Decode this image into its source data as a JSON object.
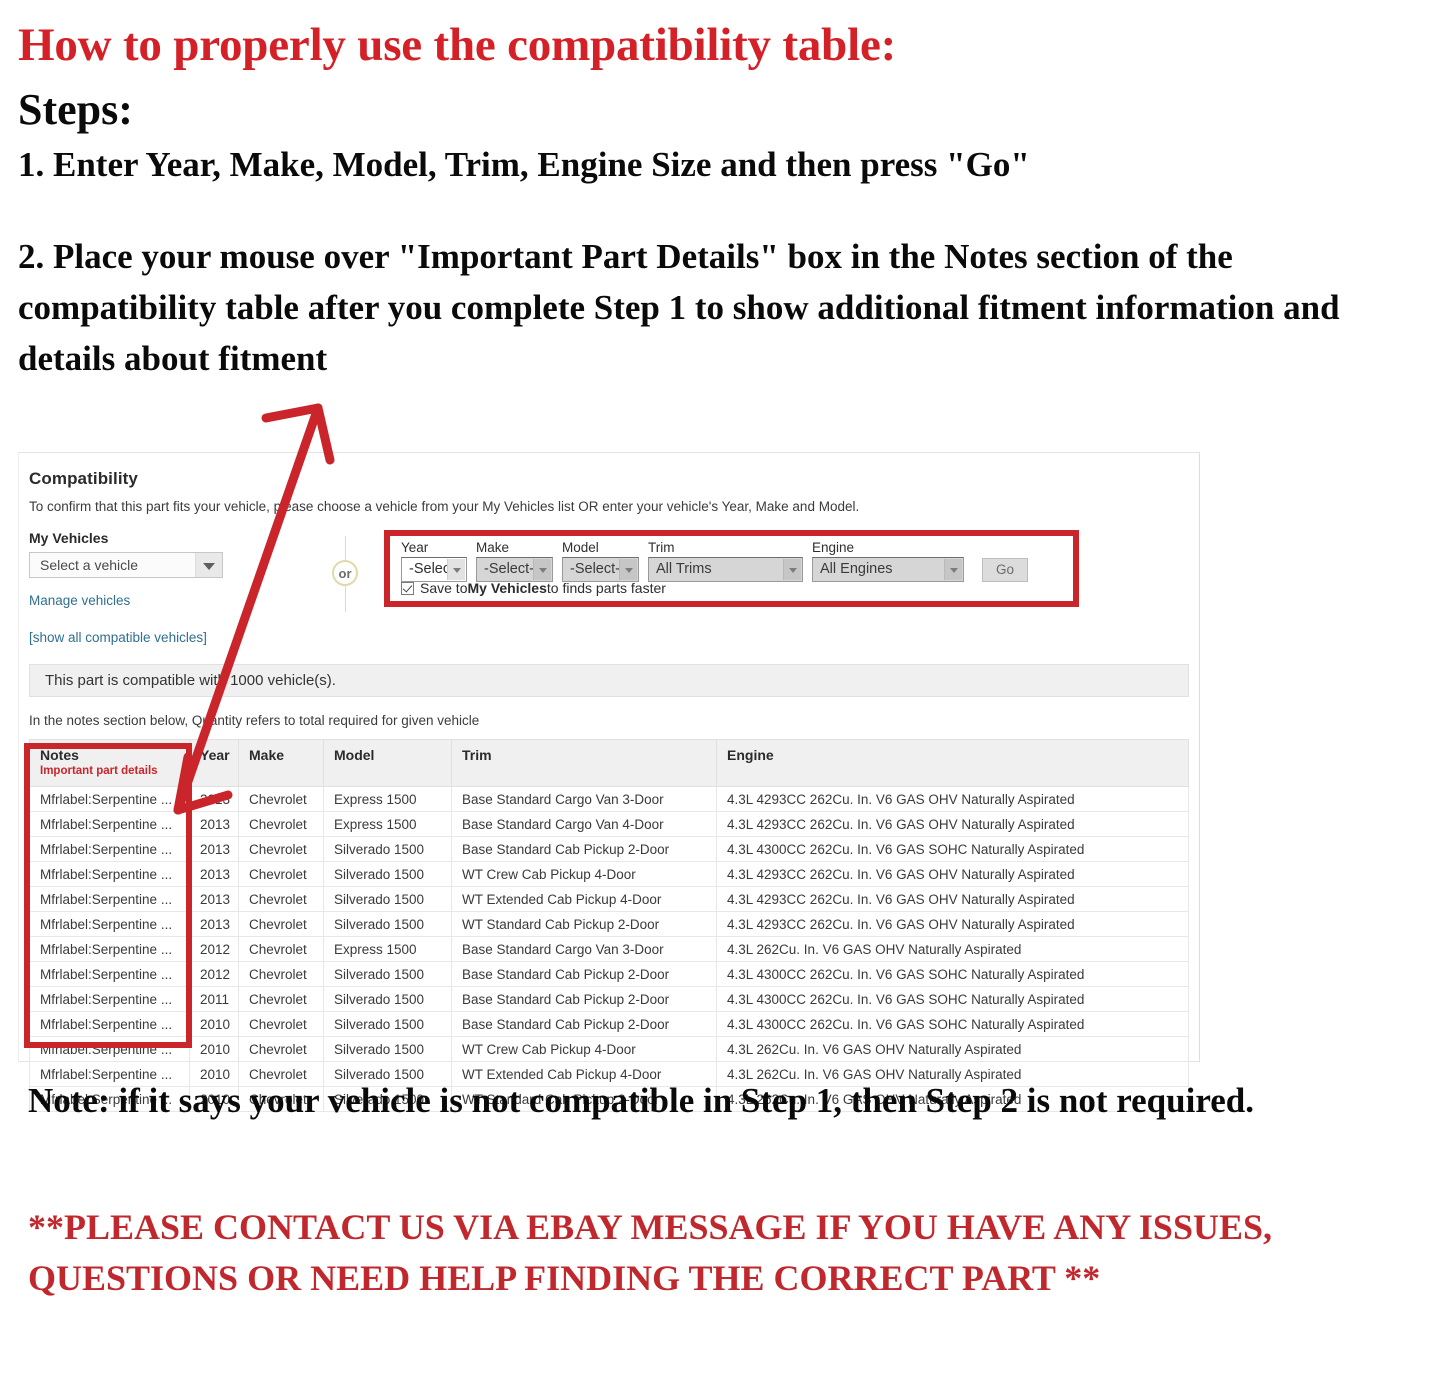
{
  "instructions": {
    "headline": "How to properly use the compatibility table:",
    "steps_label": "Steps:",
    "step_one": "1. Enter Year, Make, Model, Trim, Engine Size and then press \"Go\"",
    "step_two": "2. Place your mouse over \"Important Part Details\" box in the Notes section of the compatibility table after you complete Step 1 to show additional fitment information and details about fitment",
    "note": "Note: if it says your vehicle is not compatible in Step 1, then Step 2 is not required.",
    "contact": "**PLEASE CONTACT US VIA EBAY MESSAGE IF YOU HAVE ANY ISSUES, QUESTIONS OR NEED HELP FINDING THE CORRECT PART **"
  },
  "colors": {
    "headline_red": "#d42027",
    "annotation_red": "#c9252b",
    "contact_red": "#c0282d",
    "link_blue": "#2f6f8f",
    "or_circle_border": "#e2d9ab"
  },
  "compatibility": {
    "title": "Compatibility",
    "subtitle": "To confirm that this part fits your vehicle, please choose a vehicle from your My Vehicles list OR enter your vehicle's Year, Make and Model.",
    "my_vehicles_label": "My Vehicles",
    "vehicle_select_value": "Select a vehicle",
    "manage_vehicles_link": "Manage vehicles",
    "show_all_link": "[show all compatible vehicles]",
    "or_text": "or",
    "finder": {
      "fields": [
        {
          "label": "Year",
          "value": "-Select-",
          "disabled": false
        },
        {
          "label": "Make",
          "value": "-Select-",
          "disabled": true
        },
        {
          "label": "Model",
          "value": "-Select-",
          "disabled": true
        },
        {
          "label": "Trim",
          "value": "All Trims",
          "disabled": true
        },
        {
          "label": "Engine",
          "value": "All Engines",
          "disabled": true
        }
      ],
      "go_label": "Go",
      "save_checkbox_checked": true,
      "save_text_prefix": "Save to ",
      "save_text_bold": "My Vehicles",
      "save_text_suffix": " to finds parts faster"
    },
    "count_text": "This part is compatible with 1000 vehicle(s).",
    "quantity_note": "In the notes section below, Quantity refers to total required for given vehicle",
    "table": {
      "headers": {
        "notes": "Notes",
        "notes_sub": "Important part details",
        "year": "Year",
        "make": "Make",
        "model": "Model",
        "trim": "Trim",
        "engine": "Engine"
      },
      "rows": [
        {
          "notes": "Mfrlabel:Serpentine ...",
          "year": "2013",
          "make": "Chevrolet",
          "model": "Express 1500",
          "trim": "Base Standard Cargo Van 3-Door",
          "engine": "4.3L 4293CC 262Cu. In. V6 GAS OHV Naturally Aspirated"
        },
        {
          "notes": "Mfrlabel:Serpentine ...",
          "year": "2013",
          "make": "Chevrolet",
          "model": "Express 1500",
          "trim": "Base Standard Cargo Van 4-Door",
          "engine": "4.3L 4293CC 262Cu. In. V6 GAS OHV Naturally Aspirated"
        },
        {
          "notes": "Mfrlabel:Serpentine ...",
          "year": "2013",
          "make": "Chevrolet",
          "model": "Silverado 1500",
          "trim": "Base Standard Cab Pickup 2-Door",
          "engine": "4.3L 4300CC 262Cu. In. V6 GAS SOHC Naturally Aspirated"
        },
        {
          "notes": "Mfrlabel:Serpentine ...",
          "year": "2013",
          "make": "Chevrolet",
          "model": "Silverado 1500",
          "trim": "WT Crew Cab Pickup 4-Door",
          "engine": "4.3L 4293CC 262Cu. In. V6 GAS OHV Naturally Aspirated"
        },
        {
          "notes": "Mfrlabel:Serpentine ...",
          "year": "2013",
          "make": "Chevrolet",
          "model": "Silverado 1500",
          "trim": "WT Extended Cab Pickup 4-Door",
          "engine": "4.3L 4293CC 262Cu. In. V6 GAS OHV Naturally Aspirated"
        },
        {
          "notes": "Mfrlabel:Serpentine ...",
          "year": "2013",
          "make": "Chevrolet",
          "model": "Silverado 1500",
          "trim": "WT Standard Cab Pickup 2-Door",
          "engine": "4.3L 4293CC 262Cu. In. V6 GAS OHV Naturally Aspirated"
        },
        {
          "notes": "Mfrlabel:Serpentine ...",
          "year": "2012",
          "make": "Chevrolet",
          "model": "Express 1500",
          "trim": "Base Standard Cargo Van 3-Door",
          "engine": "4.3L 262Cu. In. V6 GAS OHV Naturally Aspirated"
        },
        {
          "notes": "Mfrlabel:Serpentine ...",
          "year": "2012",
          "make": "Chevrolet",
          "model": "Silverado 1500",
          "trim": "Base Standard Cab Pickup 2-Door",
          "engine": "4.3L 4300CC 262Cu. In. V6 GAS SOHC Naturally Aspirated"
        },
        {
          "notes": "Mfrlabel:Serpentine ...",
          "year": "2011",
          "make": "Chevrolet",
          "model": "Silverado 1500",
          "trim": "Base Standard Cab Pickup 2-Door",
          "engine": "4.3L 4300CC 262Cu. In. V6 GAS SOHC Naturally Aspirated"
        },
        {
          "notes": "Mfrlabel:Serpentine ...",
          "year": "2010",
          "make": "Chevrolet",
          "model": "Silverado 1500",
          "trim": "Base Standard Cab Pickup 2-Door",
          "engine": "4.3L 4300CC 262Cu. In. V6 GAS SOHC Naturally Aspirated"
        },
        {
          "notes": "Mfrlabel:Serpentine ...",
          "year": "2010",
          "make": "Chevrolet",
          "model": "Silverado 1500",
          "trim": "WT Crew Cab Pickup 4-Door",
          "engine": "4.3L 262Cu. In. V6 GAS OHV Naturally Aspirated"
        },
        {
          "notes": "Mfrlabel:Serpentine ...",
          "year": "2010",
          "make": "Chevrolet",
          "model": "Silverado 1500",
          "trim": "WT Extended Cab Pickup 4-Door",
          "engine": "4.3L 262Cu. In. V6 GAS OHV Naturally Aspirated"
        },
        {
          "notes": "Mfrlabel:Serpentine ...",
          "year": "2010",
          "make": "Chevrolet",
          "model": "Silverado 1500",
          "trim": "WT Standard Cab Pickup 2-Door",
          "engine": "4.3L 262Cu. In. V6 GAS OHV Naturally Aspirated"
        }
      ]
    }
  }
}
